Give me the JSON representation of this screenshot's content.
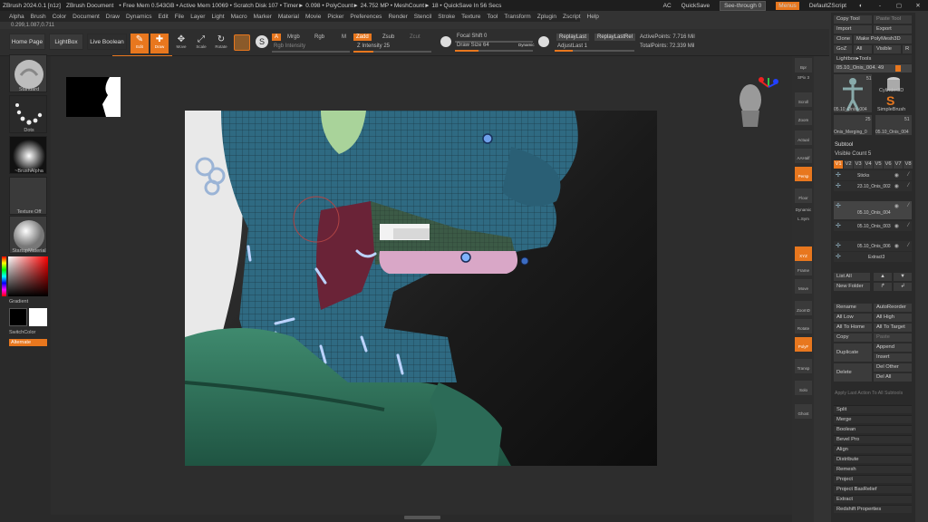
{
  "titlebar": {
    "items": [
      "ZBrush 2024.0.1 [n1z]",
      "ZBrush Document",
      "• Free Mem 0.543GB • Active Mem 10069 • Scratch Disk 107 • Timer► 0.098 • PolyCount► 24.752 MP • MeshCount► 18 • QuickSave In 56 Secs"
    ],
    "ac": "AC",
    "quicksave": "QuickSave",
    "see_through": "See-through   0",
    "menus": "Menus",
    "default_zscript": "DefaultZScript",
    "win_controls": [
      "◐",
      "-",
      "▢",
      "✕"
    ]
  },
  "menubar": [
    "Alpha",
    "Brush",
    "Color",
    "Document",
    "Draw",
    "Dynamics",
    "Edit",
    "File",
    "Layer",
    "Light",
    "Macro",
    "Marker",
    "Material",
    "Movie",
    "Picker",
    "Preferences",
    "Render",
    "Stencil",
    "Stroke",
    "Texture",
    "Tool",
    "Transform",
    "Zplugin",
    "Zscript",
    "Help"
  ],
  "coords": "0.299,1.087,0.711",
  "shelf": {
    "home_page": "Home Page",
    "lightbox": "LightBox",
    "live_boolean": "Live Boolean",
    "tools": [
      {
        "label": "Edit",
        "icon": "✎",
        "on": true
      },
      {
        "label": "Draw",
        "icon": "✚",
        "on": true
      },
      {
        "label": "Move",
        "icon": "✥",
        "on": false
      },
      {
        "label": "Scale",
        "icon": "⤢",
        "on": false
      },
      {
        "label": "Rotate",
        "icon": "↻",
        "on": false
      }
    ],
    "a_btn": "A",
    "mrgb": "Mrgb",
    "rgb": "Rgb",
    "m": "M",
    "zadd": "Zadd",
    "zsub": "Zsub",
    "zcut": "Zcut",
    "rgb_intensity": "Rgb Intensity",
    "z_intensity": "Z Intensity 25",
    "z_intensity_value": 25,
    "focal_shift": "Focal Shift 0",
    "draw_size": "Draw Size 64",
    "draw_size_value": 64,
    "dynamic": "Dynamic",
    "replay_last": "ReplayLast",
    "replay_last_rel": "ReplayLastRel",
    "adjust_last": "AdjustLast 1",
    "active_points": "ActivePoints: 7.716 Mil",
    "total_points": "TotalPoints: 72.339 Mil"
  },
  "left": {
    "brush": "Standard",
    "stroke": "Dots",
    "alpha": "~BrushAlpha",
    "texture": "Texture Off",
    "material": "StartupMaterial",
    "gradient": "Gradient",
    "switch_color": "SwitchColor",
    "alternate": "Alternate"
  },
  "rtool": [
    "Bpr",
    "SPix 3",
    "Scroll",
    "Zoom",
    "Actual",
    "AAHalf",
    "Persp",
    "Floor",
    "Dynamic",
    "L.Sym",
    "XYZ",
    "Frame",
    "Move",
    "ZoomD",
    "Rotate",
    "PolyF",
    "Transp",
    "Solo",
    "Ghost"
  ],
  "rpanel": {
    "copy_tool": "Copy Tool",
    "paste_tool": "Paste Tool",
    "import": "Import",
    "export": "Export",
    "clone": "Clone",
    "make_polymesh": "Make PolyMesh3D",
    "goz": "GoZ",
    "all": "All",
    "visible": "Visible",
    "r": "R",
    "lightbox_tools": "Lightbox▸Tools",
    "tool_name": "05.10_Onis_004. 49",
    "thumb_num_51": "51",
    "thumb_name_1": "05.10_Onis_004",
    "cylinder3d": "Cylinder3D",
    "simplebrush": "SimpleBrush",
    "thumb_num_25": "25",
    "thumb_name_2": "Onis_Merging_0",
    "thumb_name_3": "05.10_Onis_004",
    "subtool": "Subtool",
    "visible_count": "Visible Count 5",
    "v_tabs": [
      "V1",
      "V2",
      "V3",
      "V4",
      "V5",
      "V6",
      "V7",
      "V8"
    ],
    "subtools": [
      "Sticks",
      "23.10_Onis_002",
      "05.10_Onis_004",
      "05.10_Onis_003",
      "05.10_Onis_006",
      "Extract3"
    ],
    "list_all": "List All",
    "new_folder": "New Folder",
    "rename": "Rename",
    "auto_reorder": "AutoReorder",
    "all_low": "All Low",
    "all_high": "All High",
    "all_to_home": "All To Home",
    "all_to_target": "All To Target",
    "copy": "Copy",
    "paste": "Paste",
    "duplicate": "Duplicate",
    "append": "Append",
    "insert": "Insert",
    "delete": "Delete",
    "del_other": "Del Other",
    "del_all": "Del All",
    "apply_last": "Apply Last Action To All Subtools",
    "menu_list": [
      "Split",
      "Merge",
      "Boolean",
      "Bevel Pro",
      "Align",
      "Distribute",
      "Remesh",
      "Project",
      "Project BasRelief",
      "Extract",
      "Redshift Properties"
    ]
  },
  "colors": {
    "accent": "#e8771e",
    "skin": "#2f6a82",
    "cloth": "#2e6b57",
    "lip": "#d9a7c7",
    "horn": "#a9d39a"
  }
}
